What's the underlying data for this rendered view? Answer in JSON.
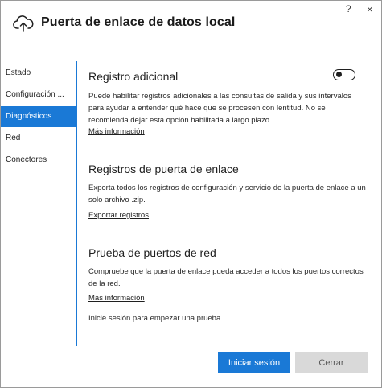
{
  "window": {
    "title": "Puerta de enlace de datos local",
    "help_label": "?",
    "close_label": "×",
    "app_icon": "cloud-upload-icon"
  },
  "sidebar": {
    "items": [
      {
        "label": "Estado",
        "active": false
      },
      {
        "label": "Configuración ...",
        "active": false
      },
      {
        "label": "Diagnósticos",
        "active": true
      },
      {
        "label": "Red",
        "active": false
      },
      {
        "label": "Conectores",
        "active": false
      }
    ]
  },
  "diagnostics": {
    "additional_logging": {
      "title": "Registro adicional",
      "description": "Puede habilitar registros adicionales a las consultas de salida y sus intervalos para ayudar a entender qué hace que se procesen con lentitud. No se recomienda dejar esta opción habilitada a largo plazo.",
      "link": "Más información",
      "toggle_on": false
    },
    "gateway_logs": {
      "title": "Registros de puerta de enlace",
      "description": "Exporta todos los registros de configuración y servicio de la puerta de enlace a un solo archivo .zip.",
      "link": "Exportar registros"
    },
    "network_ports": {
      "title": "Prueba de puertos de red",
      "description": "Compruebe que la puerta de enlace pueda acceder a todos los puertos correctos de la red.",
      "link": "Más información",
      "status": "Inicie sesión para empezar una prueba."
    }
  },
  "footer": {
    "primary_label": "Iniciar sesión",
    "secondary_label": "Cerrar"
  },
  "colors": {
    "accent": "#1a79d6",
    "disabled_button": "#d9d9d9"
  }
}
